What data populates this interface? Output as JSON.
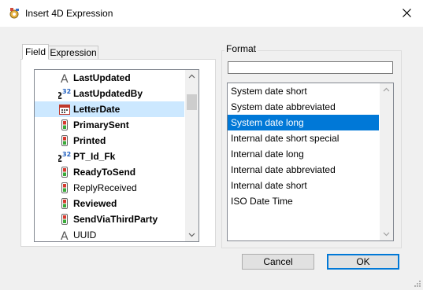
{
  "window": {
    "title": "Insert 4D Expression",
    "close_icon": "close-icon",
    "app_icon": "gear-expression-icon"
  },
  "tabs": [
    {
      "label": "Field",
      "active": true
    },
    {
      "label": "Expression",
      "active": false
    }
  ],
  "fields": [
    {
      "label": "LastUpdated",
      "type_icon": "text-type-icon",
      "bold": true,
      "selected": false
    },
    {
      "label": "LastUpdatedBy",
      "type_icon": "integer-type-icon",
      "bold": true,
      "selected": false
    },
    {
      "label": "LetterDate",
      "type_icon": "date-type-icon",
      "bold": true,
      "selected": true
    },
    {
      "label": "PrimarySent",
      "type_icon": "boolean-type-icon",
      "bold": true,
      "selected": false
    },
    {
      "label": "Printed",
      "type_icon": "boolean-type-icon",
      "bold": true,
      "selected": false
    },
    {
      "label": "PT_Id_Fk",
      "type_icon": "integer-type-icon",
      "bold": true,
      "selected": false
    },
    {
      "label": "ReadyToSend",
      "type_icon": "boolean-type-icon",
      "bold": true,
      "selected": false
    },
    {
      "label": "ReplyReceived",
      "type_icon": "boolean-type-icon",
      "bold": false,
      "selected": false
    },
    {
      "label": "Reviewed",
      "type_icon": "boolean-type-icon",
      "bold": true,
      "selected": false
    },
    {
      "label": "SendViaThirdParty",
      "type_icon": "boolean-type-icon",
      "bold": true,
      "selected": false
    },
    {
      "label": "UUID",
      "type_icon": "text-type-icon",
      "bold": false,
      "selected": false
    }
  ],
  "format": {
    "label": "Format",
    "input_value": "",
    "options": [
      {
        "label": "System date short",
        "selected": false
      },
      {
        "label": "System date abbreviated",
        "selected": false
      },
      {
        "label": "System date long",
        "selected": true
      },
      {
        "label": "Internal date short special",
        "selected": false
      },
      {
        "label": "Internal date long",
        "selected": false
      },
      {
        "label": "Internal date abbreviated",
        "selected": false
      },
      {
        "label": "Internal date short",
        "selected": false
      },
      {
        "label": "ISO Date Time",
        "selected": false
      }
    ]
  },
  "buttons": {
    "cancel": "Cancel",
    "ok": "OK"
  },
  "colors": {
    "selection_blue": "#0078d7",
    "selection_light": "#cce8ff"
  }
}
